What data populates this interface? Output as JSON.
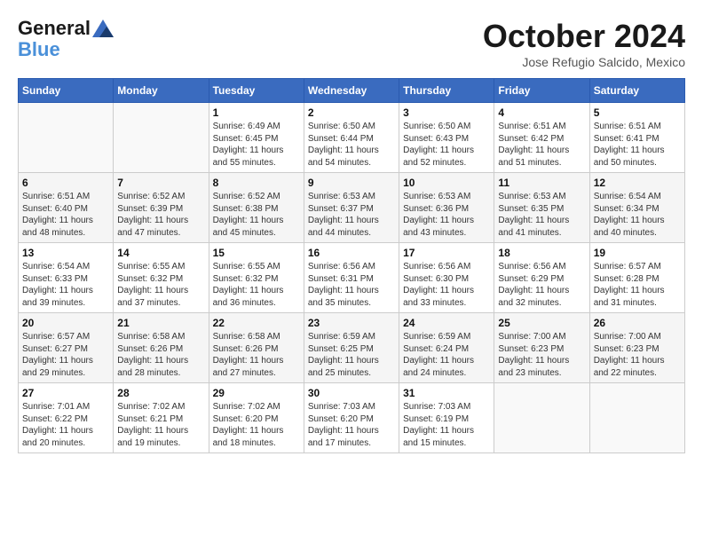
{
  "header": {
    "logo_line1": "General",
    "logo_line2": "Blue",
    "month": "October 2024",
    "location": "Jose Refugio Salcido, Mexico"
  },
  "weekdays": [
    "Sunday",
    "Monday",
    "Tuesday",
    "Wednesday",
    "Thursday",
    "Friday",
    "Saturday"
  ],
  "weeks": [
    [
      {
        "day": "",
        "sunrise": "",
        "sunset": "",
        "daylight": ""
      },
      {
        "day": "",
        "sunrise": "",
        "sunset": "",
        "daylight": ""
      },
      {
        "day": "1",
        "sunrise": "Sunrise: 6:49 AM",
        "sunset": "Sunset: 6:45 PM",
        "daylight": "Daylight: 11 hours and 55 minutes."
      },
      {
        "day": "2",
        "sunrise": "Sunrise: 6:50 AM",
        "sunset": "Sunset: 6:44 PM",
        "daylight": "Daylight: 11 hours and 54 minutes."
      },
      {
        "day": "3",
        "sunrise": "Sunrise: 6:50 AM",
        "sunset": "Sunset: 6:43 PM",
        "daylight": "Daylight: 11 hours and 52 minutes."
      },
      {
        "day": "4",
        "sunrise": "Sunrise: 6:51 AM",
        "sunset": "Sunset: 6:42 PM",
        "daylight": "Daylight: 11 hours and 51 minutes."
      },
      {
        "day": "5",
        "sunrise": "Sunrise: 6:51 AM",
        "sunset": "Sunset: 6:41 PM",
        "daylight": "Daylight: 11 hours and 50 minutes."
      }
    ],
    [
      {
        "day": "6",
        "sunrise": "Sunrise: 6:51 AM",
        "sunset": "Sunset: 6:40 PM",
        "daylight": "Daylight: 11 hours and 48 minutes."
      },
      {
        "day": "7",
        "sunrise": "Sunrise: 6:52 AM",
        "sunset": "Sunset: 6:39 PM",
        "daylight": "Daylight: 11 hours and 47 minutes."
      },
      {
        "day": "8",
        "sunrise": "Sunrise: 6:52 AM",
        "sunset": "Sunset: 6:38 PM",
        "daylight": "Daylight: 11 hours and 45 minutes."
      },
      {
        "day": "9",
        "sunrise": "Sunrise: 6:53 AM",
        "sunset": "Sunset: 6:37 PM",
        "daylight": "Daylight: 11 hours and 44 minutes."
      },
      {
        "day": "10",
        "sunrise": "Sunrise: 6:53 AM",
        "sunset": "Sunset: 6:36 PM",
        "daylight": "Daylight: 11 hours and 43 minutes."
      },
      {
        "day": "11",
        "sunrise": "Sunrise: 6:53 AM",
        "sunset": "Sunset: 6:35 PM",
        "daylight": "Daylight: 11 hours and 41 minutes."
      },
      {
        "day": "12",
        "sunrise": "Sunrise: 6:54 AM",
        "sunset": "Sunset: 6:34 PM",
        "daylight": "Daylight: 11 hours and 40 minutes."
      }
    ],
    [
      {
        "day": "13",
        "sunrise": "Sunrise: 6:54 AM",
        "sunset": "Sunset: 6:33 PM",
        "daylight": "Daylight: 11 hours and 39 minutes."
      },
      {
        "day": "14",
        "sunrise": "Sunrise: 6:55 AM",
        "sunset": "Sunset: 6:32 PM",
        "daylight": "Daylight: 11 hours and 37 minutes."
      },
      {
        "day": "15",
        "sunrise": "Sunrise: 6:55 AM",
        "sunset": "Sunset: 6:32 PM",
        "daylight": "Daylight: 11 hours and 36 minutes."
      },
      {
        "day": "16",
        "sunrise": "Sunrise: 6:56 AM",
        "sunset": "Sunset: 6:31 PM",
        "daylight": "Daylight: 11 hours and 35 minutes."
      },
      {
        "day": "17",
        "sunrise": "Sunrise: 6:56 AM",
        "sunset": "Sunset: 6:30 PM",
        "daylight": "Daylight: 11 hours and 33 minutes."
      },
      {
        "day": "18",
        "sunrise": "Sunrise: 6:56 AM",
        "sunset": "Sunset: 6:29 PM",
        "daylight": "Daylight: 11 hours and 32 minutes."
      },
      {
        "day": "19",
        "sunrise": "Sunrise: 6:57 AM",
        "sunset": "Sunset: 6:28 PM",
        "daylight": "Daylight: 11 hours and 31 minutes."
      }
    ],
    [
      {
        "day": "20",
        "sunrise": "Sunrise: 6:57 AM",
        "sunset": "Sunset: 6:27 PM",
        "daylight": "Daylight: 11 hours and 29 minutes."
      },
      {
        "day": "21",
        "sunrise": "Sunrise: 6:58 AM",
        "sunset": "Sunset: 6:26 PM",
        "daylight": "Daylight: 11 hours and 28 minutes."
      },
      {
        "day": "22",
        "sunrise": "Sunrise: 6:58 AM",
        "sunset": "Sunset: 6:26 PM",
        "daylight": "Daylight: 11 hours and 27 minutes."
      },
      {
        "day": "23",
        "sunrise": "Sunrise: 6:59 AM",
        "sunset": "Sunset: 6:25 PM",
        "daylight": "Daylight: 11 hours and 25 minutes."
      },
      {
        "day": "24",
        "sunrise": "Sunrise: 6:59 AM",
        "sunset": "Sunset: 6:24 PM",
        "daylight": "Daylight: 11 hours and 24 minutes."
      },
      {
        "day": "25",
        "sunrise": "Sunrise: 7:00 AM",
        "sunset": "Sunset: 6:23 PM",
        "daylight": "Daylight: 11 hours and 23 minutes."
      },
      {
        "day": "26",
        "sunrise": "Sunrise: 7:00 AM",
        "sunset": "Sunset: 6:23 PM",
        "daylight": "Daylight: 11 hours and 22 minutes."
      }
    ],
    [
      {
        "day": "27",
        "sunrise": "Sunrise: 7:01 AM",
        "sunset": "Sunset: 6:22 PM",
        "daylight": "Daylight: 11 hours and 20 minutes."
      },
      {
        "day": "28",
        "sunrise": "Sunrise: 7:02 AM",
        "sunset": "Sunset: 6:21 PM",
        "daylight": "Daylight: 11 hours and 19 minutes."
      },
      {
        "day": "29",
        "sunrise": "Sunrise: 7:02 AM",
        "sunset": "Sunset: 6:20 PM",
        "daylight": "Daylight: 11 hours and 18 minutes."
      },
      {
        "day": "30",
        "sunrise": "Sunrise: 7:03 AM",
        "sunset": "Sunset: 6:20 PM",
        "daylight": "Daylight: 11 hours and 17 minutes."
      },
      {
        "day": "31",
        "sunrise": "Sunrise: 7:03 AM",
        "sunset": "Sunset: 6:19 PM",
        "daylight": "Daylight: 11 hours and 15 minutes."
      },
      {
        "day": "",
        "sunrise": "",
        "sunset": "",
        "daylight": ""
      },
      {
        "day": "",
        "sunrise": "",
        "sunset": "",
        "daylight": ""
      }
    ]
  ]
}
